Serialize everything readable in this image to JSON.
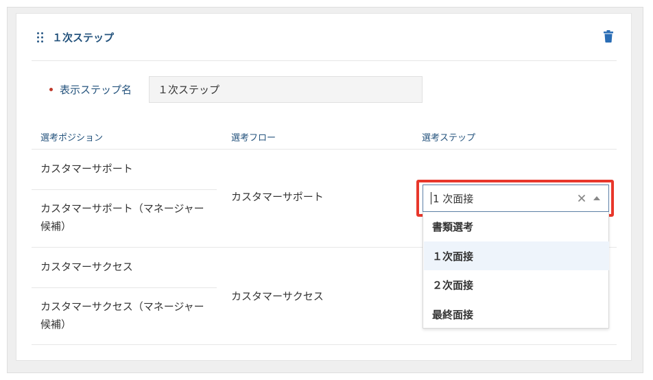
{
  "step": {
    "title": "１次ステップ",
    "name_label": "表示ステップ名",
    "name_value": "１次ステップ"
  },
  "table": {
    "headers": {
      "position": "選考ポジション",
      "flow": "選考フロー",
      "step": "選考ステップ"
    },
    "groups": [
      {
        "positions": [
          "カスタマーサポート",
          "カスタマーサポート（マネージャー候補）"
        ],
        "flow": "カスタマーサポート"
      },
      {
        "positions": [
          "カスタマーサクセス",
          "カスタマーサクセス（マネージャー候補）"
        ],
        "flow": "カスタマーサクセス"
      }
    ]
  },
  "step_select": {
    "value": "1 次面接",
    "options": [
      "書類選考",
      "１次面接",
      "２次面接",
      "最終面接"
    ],
    "active_index": 1
  },
  "colors": {
    "accent": "#23527c",
    "required": "#c0392b",
    "highlight": "#e8372b",
    "option_hover": "#eef4fb"
  }
}
